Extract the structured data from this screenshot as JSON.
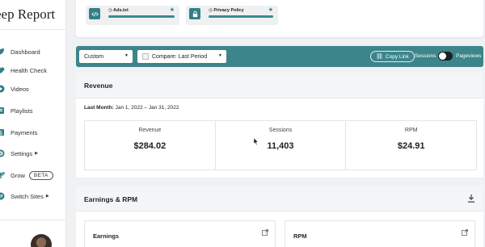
{
  "sidebar": {
    "brand": "eep Report",
    "items": [
      {
        "label": "Dashboard",
        "icon": "leaf-icon"
      },
      {
        "label": "Health Check",
        "icon": "heart-icon"
      },
      {
        "label": "Videos",
        "icon": "play-icon"
      },
      {
        "label": "Playlists",
        "icon": "playlist-icon"
      },
      {
        "label": "Payments",
        "icon": "dollar-icon"
      },
      {
        "label": "Settings",
        "icon": "gear-icon"
      },
      {
        "label": "Grow",
        "icon": "sprout-icon",
        "badge": "BETA"
      },
      {
        "label": "Switch Sites",
        "icon": "swap-icon"
      }
    ]
  },
  "top_card": {
    "chips": [
      {
        "label": "Ads.txt",
        "icon": "code-icon",
        "status_icon": "clock-icon"
      },
      {
        "label": "Privacy Policy",
        "icon": "lock-icon",
        "status_icon": "clock-icon"
      }
    ]
  },
  "filters": {
    "range": "Custom",
    "compare": "Compare: Last Period",
    "copy_link": "Copy Link",
    "toggle_left": "Sessions",
    "toggle_right": "Pageviews"
  },
  "revenue": {
    "title": "Revenue",
    "period_label": "Last Month:",
    "period_value": "Jan 1, 2022 – Jan 31, 2022",
    "metrics": [
      {
        "label": "Revenue",
        "value": "$284.02"
      },
      {
        "label": "Sessions",
        "value": "11,403"
      },
      {
        "label": "RPM",
        "value": "$24.91"
      }
    ]
  },
  "earnings_rpm": {
    "title": "Earnings & RPM",
    "cards": [
      {
        "label": "Earnings"
      },
      {
        "label": "RPM"
      }
    ]
  },
  "colors": {
    "accent": "#3c858b",
    "icon_teal": "#337f85"
  }
}
